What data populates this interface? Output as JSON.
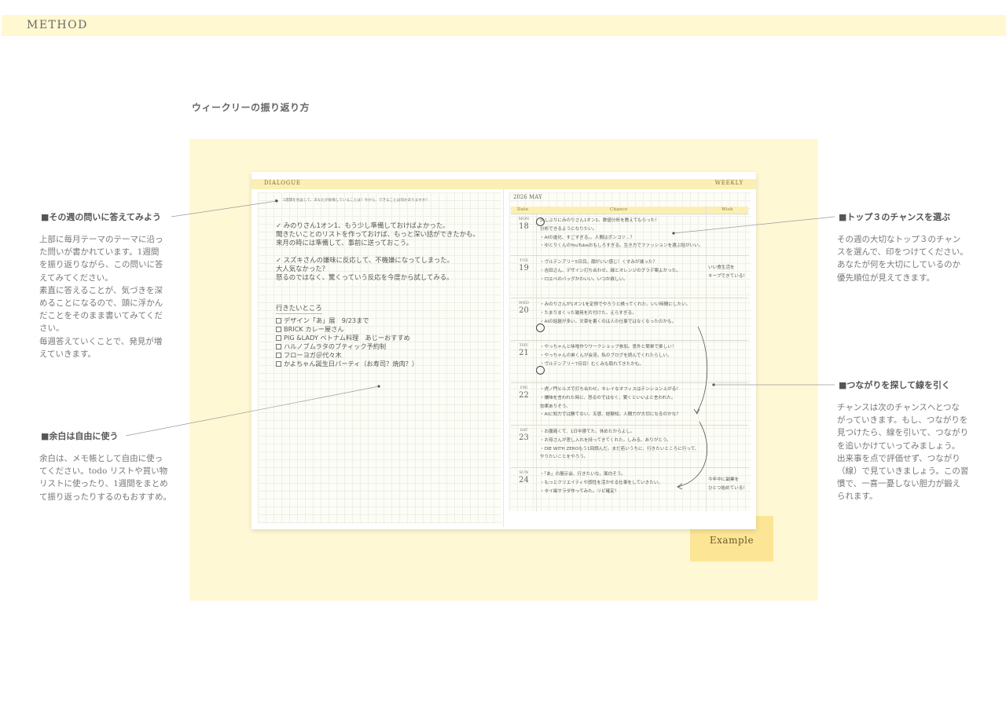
{
  "header": {
    "section_label": "METHOD"
  },
  "page": {
    "title": "ウィークリーの振り返り方"
  },
  "notebook": {
    "left_label": "DIALOGUE",
    "right_label": "WEEKLY",
    "question": "1週間を見返して、あなたが後悔していることは？今から、できることは何かありますか？",
    "answers": [
      "✓ みのりさん1オン1、もう少し準備しておけばよかった。",
      "聞きたいことのリストを作っておけば、もっと深い話ができたかも。",
      "来月の時には準備して、事前に送っておこう。",
      "✓ スズキさんの嫌味に反応して、不機嫌になってしまった。",
      "大人気なかった？",
      "怒るのではなく、驚くっていう反応を今度から試してみる。"
    ],
    "wish_title": "行きたいところ",
    "wish_items": [
      "デザイン「あ」展　9/23まで",
      "BRICK カレー屋さん",
      "PIG &LADY ベトナム料理　あじーおすすめ",
      "ハルノブムラタのブティック予約制",
      "フローヨガ＠代々木",
      "かよちゃん誕生日パーティ（お寿司？焼肉？）"
    ],
    "month": "2026  MAY",
    "columns": {
      "date": "Date",
      "chance": "Chance",
      "wish": "Wish"
    },
    "days": [
      {
        "name": "MON",
        "num": "18",
        "items": [
          "久しぶりにみのりさん1オン1。数値分析を教えてもらった！",
          "  分析できるようになりたい。",
          "・AIの進化、すごすぎる。。人間はポンコツ…？",
          "・ゆとりくんのYouTubeおもしろすぎる。生き方でファッションを選ぶ話がいい。"
        ],
        "wish": []
      },
      {
        "name": "TUE",
        "num": "19",
        "items": [
          "・ヴルテンアリー5日目。顔がいい感じ！くすみが減った？",
          "・吉田さん、デザイン打ち合わせ。緑とオレンジのグラデ案よかった。",
          "・ロエベのバッグかわいい。いつか欲しい。"
        ],
        "wish": [
          "いい食生活を",
          "キープできている！"
        ]
      },
      {
        "name": "WED",
        "num": "20",
        "items": [
          "・みのりさんが1オン1を定例でやろうと誘ってくれた。いい時間にしたい。",
          "・たまりまくった雑用を片付けた。えらすぎる。",
          "・AIの話題が多い。文章を書くのは人の仕事ではなくなったのかも。"
        ],
        "wish": []
      },
      {
        "name": "THU",
        "num": "21",
        "items": [
          "・やっちゃんと味噌作りワークショップ参加。意外と簡単で楽しい！",
          "・やっちゃんの弟くんが会流。私のブログを読んでくれたらしい。",
          "・ヴルテンアリー7日目！むくみも取れてきたかも。"
        ],
        "wish": []
      },
      {
        "name": "FRI",
        "num": "22",
        "items": [
          "・虎ノ門ヒルズで打ち合わせ。キレイなオフィスはテンション上がる！",
          "・嫌味を言われた時に、怒るのではなく、驚くといいよと言われた。",
          "  効果ありそう。",
          "・AIに知力では勝てない。五感、経験知。人間力が大切になるのかな？"
        ],
        "wish": []
      },
      {
        "name": "SAT",
        "num": "23",
        "items": [
          "・お腹痛くて、1日中寝てた。休めたからよし。",
          "・お母さんが差し入れを持ってきてくれた。しみる。ありがとう。",
          "・DIE WITH ZEROもう1回読んだ。まだ若いうちに、行きたいところに行って、",
          "  やりたいことをやろう。"
        ],
        "wish": []
      },
      {
        "name": "SUN",
        "num": "24",
        "items": [
          "・「あ」の展示会、行きたいな。面白そう。",
          "・もっとクリエイティや感性を活かせる仕事をしていきたい。",
          "・タイ風サラダ作ってみた。リピ確定！"
        ],
        "wish": [
          "今年中に副業を",
          "ひとつ始めている！"
        ]
      }
    ]
  },
  "example_tag": "Example",
  "tips": [
    {
      "heading": "■その週の問いに答えてみよう",
      "body": [
        "上部に毎月テーマのテーマに沿っ",
        "た問いが書かれています。1週間",
        "を振り返りながら、この問いに答",
        "えてみてください。",
        "素直に答えることが、気づきを深",
        "めることになるので、頭に浮かん",
        "だことをそのまま書いてみてくだ",
        "さい。",
        "毎週答えていくことで、発見が増",
        "えていきます。"
      ]
    },
    {
      "heading": "■余白は自由に使う",
      "body": [
        "余白は、メモ帳として自由に使っ",
        "てください。todo リストや買い物",
        "リストに使ったり、1週間をまとめ",
        "て振り返ったりするのもおすすめ。"
      ]
    },
    {
      "heading": "■トップ３のチャンスを選ぶ",
      "body": [
        "その週の大切なトップ３のチャン",
        "スを選んで、印をつけてください。",
        "あなたが何を大切にしているのか",
        "優先順位が見えてきます。"
      ]
    },
    {
      "heading": "■つながりを探して線を引く",
      "body": [
        "チャンスは次のチャンスへとつな",
        "がっていきます。もし、つながりを",
        "見つけたら、線を引いて、つながり",
        "を追いかけていってみましょう。",
        "出来事を点で評価せず、つながり",
        "（線）で見ていきましょう。この習",
        "慣で、一喜一憂しない胆力が鍛え",
        "られます。"
      ]
    }
  ]
}
